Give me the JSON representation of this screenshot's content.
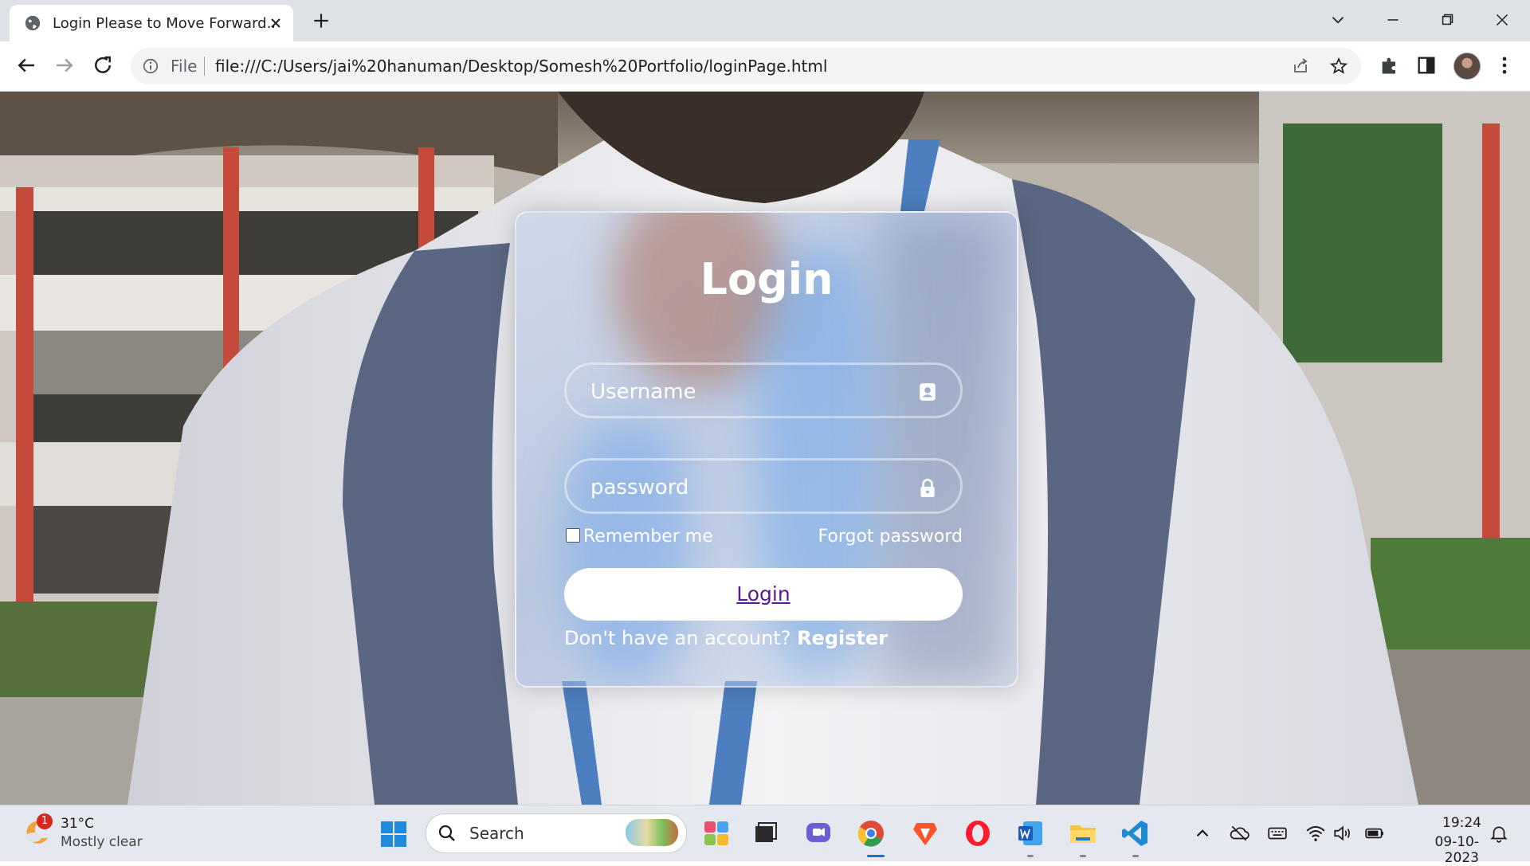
{
  "browser": {
    "tab_title": "Login Please to Move Forward..",
    "file_label": "File",
    "url": "file:///C:/Users/jai%20hanuman/Desktop/Somesh%20Portfolio/loginPage.html"
  },
  "login": {
    "title": "Login",
    "username_placeholder": "Username",
    "password_placeholder": "password",
    "remember_label": "Remember me",
    "forgot_label": "Forgot password",
    "button_label": "Login",
    "no_account_text": "Don't have an account?",
    "register_label": "Register"
  },
  "taskbar": {
    "weather_temp": "31°C",
    "weather_desc": "Mostly clear",
    "weather_badge": "1",
    "search_label": "Search",
    "time": "19:24",
    "date": "09-10-2023"
  },
  "colors": {
    "login_button_text": "#5b1a8e",
    "tabbar_bg": "#dee1e6",
    "taskbar_bg": "#e6e8ef"
  }
}
